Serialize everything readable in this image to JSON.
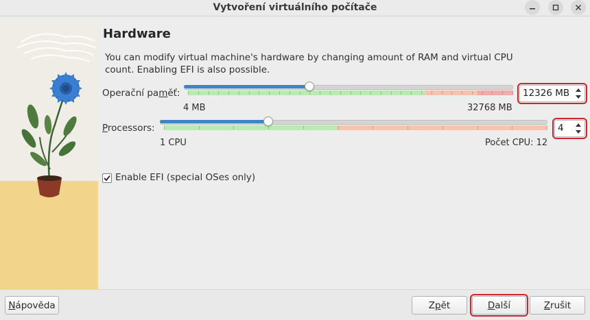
{
  "window": {
    "title": "Vytvoření virtuálního počítače",
    "controls": [
      {
        "name": "minimize-icon"
      },
      {
        "name": "maximize-icon"
      },
      {
        "name": "close-icon"
      }
    ]
  },
  "page": {
    "heading": "Hardware",
    "description": "You can modify virtual machine's hardware by changing amount of RAM and virtual CPU count. Enabling EFI is also possible."
  },
  "memory": {
    "label_pre": "Operační pa",
    "label_mnemonic": "m",
    "label_post": "ěť:",
    "min_label": "4 MB",
    "max_label": "32768 MB",
    "value": "12326 MB",
    "min": 4,
    "max": 32768,
    "current": 12326,
    "zones": {
      "green_until": 0.73,
      "orange_until": 0.89
    },
    "colors": {
      "green": "#b7ebb0",
      "orange": "#f7c3ad",
      "red": "#f3aaaa"
    }
  },
  "processors": {
    "label_pre": "",
    "label_mnemonic": "P",
    "label_post": "rocessors:",
    "min_label": "1 CPU",
    "max_label": "Počet CPU: 12",
    "value": "4",
    "min": 1,
    "max": 12,
    "current": 4,
    "zones": {
      "green_until": 0.45
    },
    "colors": {
      "green": "#b7ebb0",
      "orange": "#f7c3ad"
    }
  },
  "efi": {
    "label": "Enable EFI (special OSes only)",
    "checked": true
  },
  "buttons": {
    "help_mnemonic": "N",
    "help_rest": "ápověda",
    "back_pre": "Z",
    "back_mnemonic": "p",
    "back_post": "ět",
    "next_mnemonic": "D",
    "next_rest": "alší",
    "cancel_mnemonic": "Z",
    "cancel_rest": "rušit"
  },
  "accent": "#3c85c6",
  "focus_outline": "#c8262b"
}
